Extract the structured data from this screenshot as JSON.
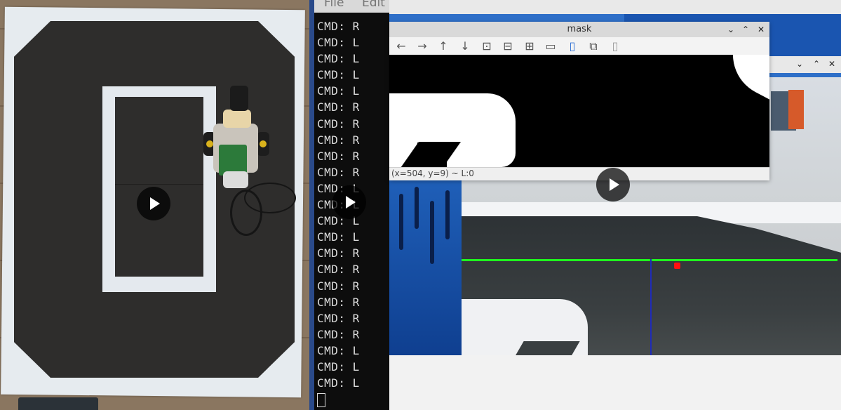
{
  "terminal": {
    "menu": [
      "File",
      "Edit"
    ],
    "lines": [
      "CMD: R",
      "CMD: L",
      "CMD: L",
      "CMD: L",
      "CMD: L",
      "CMD: R",
      "CMD: R",
      "CMD: R",
      "CMD: R",
      "CMD: R",
      "CMD: L",
      "CMD: L",
      "CMD: L",
      "CMD: L",
      "CMD: R",
      "CMD: R",
      "CMD: R",
      "CMD: R",
      "CMD: R",
      "CMD: R",
      "CMD: L",
      "CMD: L",
      "CMD: L"
    ]
  },
  "mask_window": {
    "title": "mask",
    "controls": {
      "minimize": "⌄",
      "maximize": "⌃",
      "close": "✕"
    },
    "toolbar": [
      {
        "icon": "arrow-left-icon",
        "glyph": "←"
      },
      {
        "icon": "arrow-right-icon",
        "glyph": "→"
      },
      {
        "icon": "arrow-up-icon",
        "glyph": "↑"
      },
      {
        "icon": "arrow-down-icon",
        "glyph": "↓"
      },
      {
        "icon": "zoom-in-icon",
        "glyph": "⊡"
      },
      {
        "icon": "zoom-out-icon",
        "glyph": "⊟"
      },
      {
        "icon": "zoom-reset-icon",
        "glyph": "⊞"
      },
      {
        "icon": "fit-icon",
        "glyph": "▭"
      },
      {
        "icon": "save-icon",
        "glyph": "▯"
      },
      {
        "icon": "copy-icon",
        "glyph": "⧉"
      },
      {
        "icon": "properties-icon",
        "glyph": "▯"
      }
    ],
    "status": "(x=504, y=9) ~ L:0"
  },
  "camera_window": {
    "controls": {
      "minimize": "⌄",
      "maximize": "⌃",
      "close": "✕"
    }
  },
  "colors": {
    "terminal_bg": "#0d0d0d",
    "terminal_text": "#dcdcdc",
    "desktop_blue": "#2e6fc8",
    "guide_line": "#1ef51e",
    "center_line": "#1f2bb8",
    "target_dot": "#ff1010"
  }
}
